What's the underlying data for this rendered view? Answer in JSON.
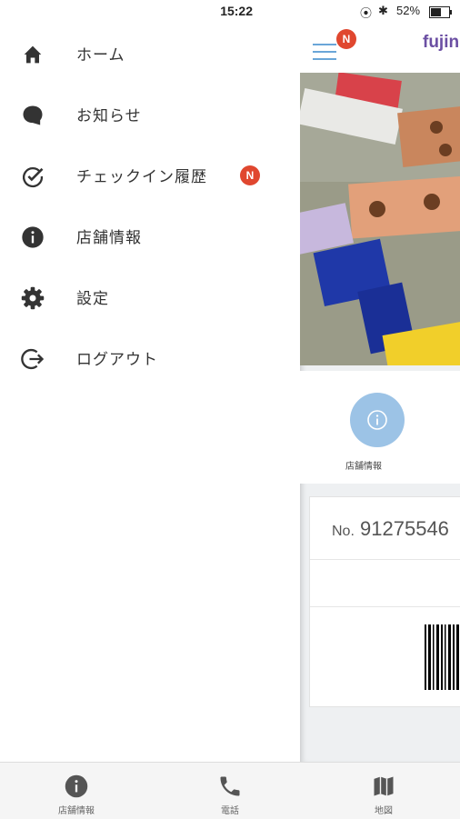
{
  "drawer": {
    "time": "15:22",
    "items": [
      {
        "label": "ホーム",
        "icon": "home-icon"
      },
      {
        "label": "お知らせ",
        "icon": "chat-bubble-icon"
      },
      {
        "label": "チェックイン履歴",
        "icon": "check-circle-icon",
        "badge": "N"
      },
      {
        "label": "店舗情報",
        "icon": "info-icon"
      },
      {
        "label": "設定",
        "icon": "gear-icon"
      },
      {
        "label": "ログアウト",
        "icon": "logout-icon"
      }
    ]
  },
  "app": {
    "status": {
      "battery": "52%"
    },
    "header": {
      "menu_badge": "N",
      "brand": "fujin"
    },
    "info_button": {
      "label": "店舗情報"
    },
    "card": {
      "number_prefix": "No.",
      "number": "91275546"
    }
  },
  "tabbar": {
    "items": [
      {
        "label": "店舗情報",
        "icon": "info-icon"
      },
      {
        "label": "電話",
        "icon": "phone-icon"
      },
      {
        "label": "地図",
        "icon": "map-icon"
      }
    ]
  },
  "colors": {
    "accent": "#6aa6d8",
    "badge": "#e0472f",
    "brand": "#6b4fa3"
  }
}
